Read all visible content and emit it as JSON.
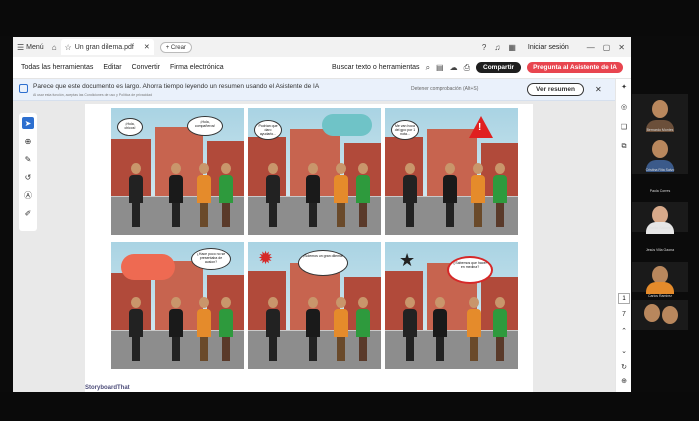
{
  "window": {
    "menu_label": "Menú",
    "tab_title": "Un gran dilema.pdf",
    "new_tab": "+ Crear",
    "login": "Iniciar sesión"
  },
  "toolbar": {
    "items": [
      "Todas las herramientas",
      "Editar",
      "Convertir",
      "Firma electrónica"
    ],
    "search": "Buscar texto o herramientas",
    "share": "Compartir",
    "ai_assistant": "Pregunta al Asistente de IA"
  },
  "notice": {
    "message": "Parece que este documento es largo. Ahorra tiempo leyendo un resumen usando el Asistente de IA",
    "subtext": "Al usar esta función, aceptas las Condiciones de uso y Política de privacidad",
    "mid_text": "Detener comprobación (Alt+S)",
    "summary_button": "Ver resumen"
  },
  "page_numbers": [
    "1",
    "7"
  ],
  "brand": "StoryboardThat",
  "panels": [
    {
      "bubble_a": "¡Hola, chicos!",
      "bubble_b": "¡Hola, compañeros!"
    },
    {
      "bubble_a": "Podrían que daro ayudarlo..."
    },
    {
      "bubble_a": "Me van hoca del gpo por 1 nota..."
    },
    {},
    {
      "bubble_a": "¿Hace poco no se presentaba de ausion?",
      "bubble_b": ""
    },
    {
      "bubble_a": "¡Solemos un gran dilema!"
    }
  ],
  "extra_panel": {
    "bubble_a": "¿Sabemos que hacer en medina?"
  },
  "participants": [
    {
      "label": "Bernardo Montes"
    },
    {
      "label": "Cristina Rita Salvo"
    },
    {
      "label": "Paola Corres"
    },
    {
      "label": "Emilio Salome"
    },
    {
      "label": "Jesús Villa Gaona"
    },
    {
      "label": "Carlos Ramirez"
    }
  ],
  "colors": {
    "accent": "#e8454f",
    "info_blue": "#2d6fcf",
    "brick": "#b14a3a"
  }
}
